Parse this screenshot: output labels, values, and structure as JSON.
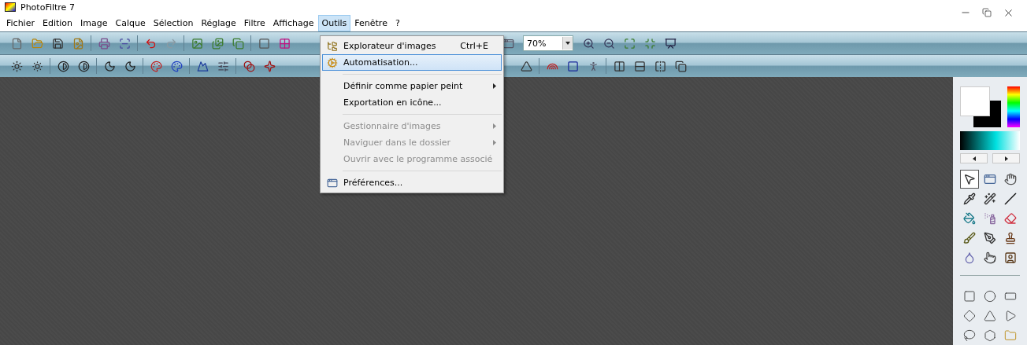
{
  "window": {
    "title": "PhotoFiltre 7"
  },
  "menu_bar": [
    {
      "label": "Fichier",
      "selected": false
    },
    {
      "label": "Edition",
      "selected": false
    },
    {
      "label": "Image",
      "selected": false
    },
    {
      "label": "Calque",
      "selected": false
    },
    {
      "label": "Sélection",
      "selected": false
    },
    {
      "label": "Réglage",
      "selected": false
    },
    {
      "label": "Filtre",
      "selected": false
    },
    {
      "label": "Affichage",
      "selected": false
    },
    {
      "label": "Outils",
      "selected": true
    },
    {
      "label": "Fenêtre",
      "selected": false
    },
    {
      "label": "?",
      "selected": false
    }
  ],
  "zoom": {
    "value": "70%"
  },
  "dropdown": [
    {
      "kind": "item",
      "label": "Explorateur d'images",
      "shortcut": "Ctrl+E",
      "disabled": false,
      "selected": false,
      "submenu": false
    },
    {
      "kind": "item",
      "label": "Automatisation...",
      "disabled": false,
      "selected": true,
      "submenu": false
    },
    {
      "kind": "separator"
    },
    {
      "kind": "item",
      "label": "Définir comme papier peint",
      "disabled": false,
      "selected": false,
      "submenu": true
    },
    {
      "kind": "item",
      "label": "Exportation en icône...",
      "disabled": false,
      "selected": false,
      "submenu": false
    },
    {
      "kind": "separator"
    },
    {
      "kind": "item",
      "label": "Gestionnaire d'images",
      "disabled": true,
      "selected": false,
      "submenu": true
    },
    {
      "kind": "item",
      "label": "Naviguer dans le dossier",
      "disabled": true,
      "selected": false,
      "submenu": true
    },
    {
      "kind": "item",
      "label": "Ouvrir avec le programme associé",
      "disabled": true,
      "selected": false,
      "submenu": false
    },
    {
      "kind": "separator"
    },
    {
      "kind": "item",
      "label": "Préférences...",
      "disabled": false,
      "selected": false,
      "submenu": false
    }
  ],
  "tools": [
    {
      "kind": "pointer",
      "selected": true
    },
    {
      "kind": "viewer",
      "selected": false
    },
    {
      "kind": "hand",
      "selected": false
    },
    {
      "kind": "pipette",
      "selected": false
    },
    {
      "kind": "wand",
      "selected": false
    },
    {
      "kind": "line",
      "selected": false
    },
    {
      "kind": "bucket",
      "selected": false
    },
    {
      "kind": "spray",
      "selected": false
    },
    {
      "kind": "eraser",
      "selected": false
    },
    {
      "kind": "brush",
      "selected": false
    },
    {
      "kind": "pen",
      "selected": false
    },
    {
      "kind": "stamp",
      "selected": false
    },
    {
      "kind": "drop",
      "selected": false
    },
    {
      "kind": "smudge",
      "selected": false
    },
    {
      "kind": "portrait",
      "selected": false
    }
  ],
  "shapes": [
    {
      "kind": "rect"
    },
    {
      "kind": "ellipse"
    },
    {
      "kind": "rounded"
    },
    {
      "kind": "diamond"
    },
    {
      "kind": "triangle"
    },
    {
      "kind": "play"
    },
    {
      "kind": "lasso"
    },
    {
      "kind": "polygon"
    },
    {
      "kind": "folder"
    }
  ]
}
